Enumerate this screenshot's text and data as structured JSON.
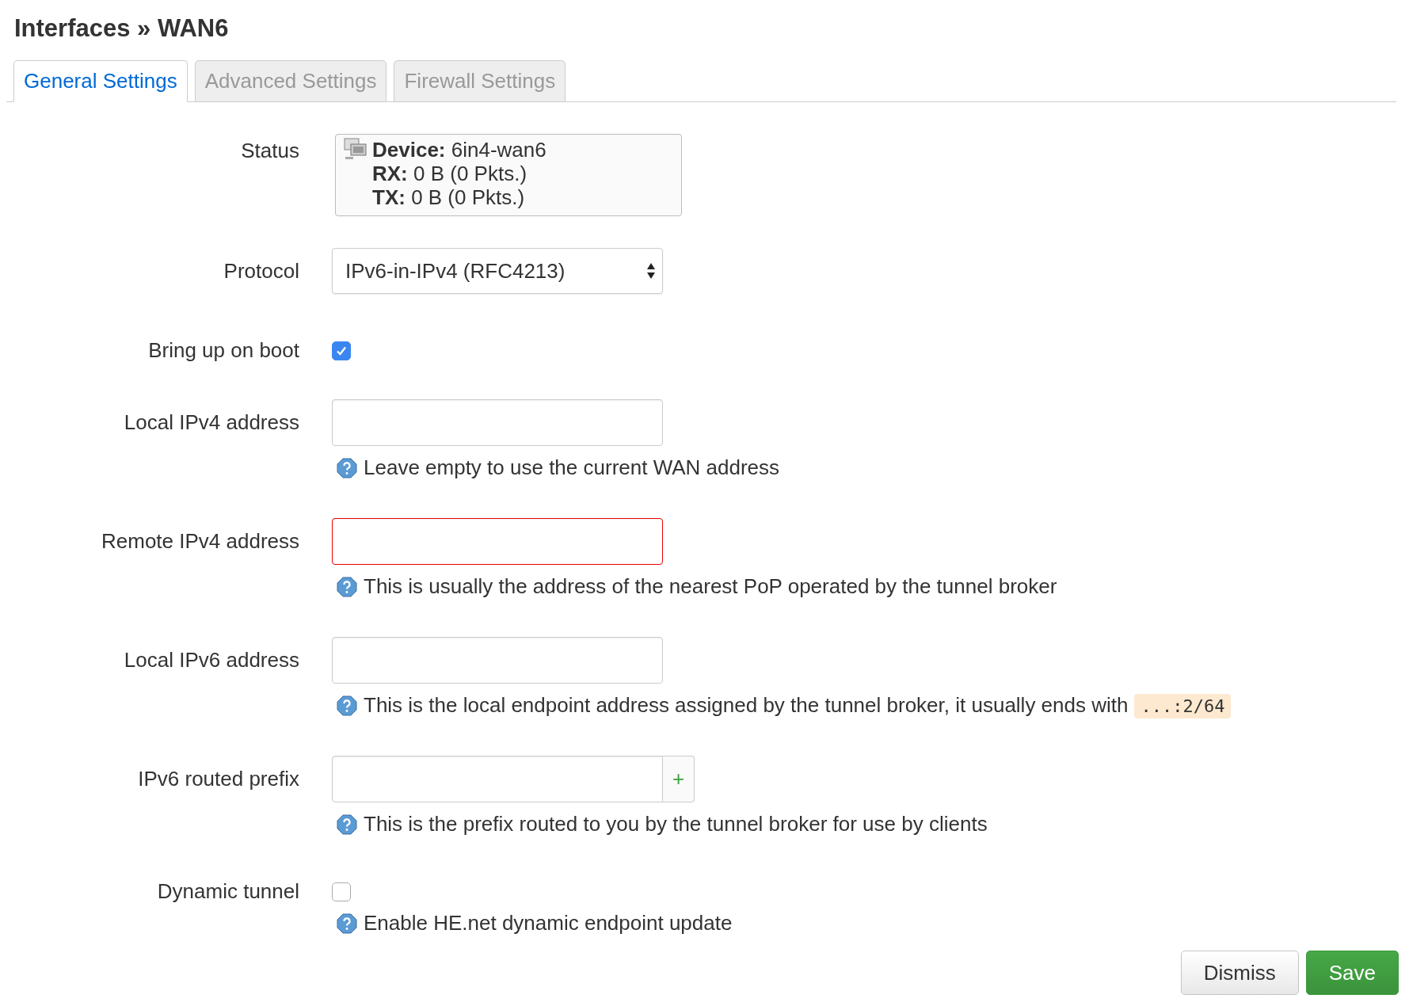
{
  "title": "Interfaces » WAN6",
  "tabs": [
    {
      "label": "General Settings",
      "selected": true
    },
    {
      "label": "Advanced Settings",
      "selected": false
    },
    {
      "label": "Firewall Settings",
      "selected": false
    }
  ],
  "fields": [
    {
      "kind": "status",
      "label": "Status",
      "lines": [
        {
          "key": "Device:",
          "value": "6in4-wan6"
        },
        {
          "key": "RX:",
          "value": "0 B (0 Pkts.)"
        },
        {
          "key": "TX:",
          "value": "0 B (0 Pkts.)"
        }
      ]
    },
    {
      "kind": "select",
      "label": "Protocol",
      "value": "IPv6-in-IPv4 (RFC4213)"
    },
    {
      "kind": "checkbox",
      "label": "Bring up on boot",
      "checked": true
    },
    {
      "kind": "text",
      "label": "Local IPv4 address",
      "invalid": false,
      "help": "Leave empty to use the current WAN address"
    },
    {
      "kind": "text",
      "label": "Remote IPv4 address",
      "invalid": true,
      "help": "This is usually the address of the nearest PoP operated by the tunnel broker"
    },
    {
      "kind": "text",
      "label": "Local IPv6 address",
      "invalid": false,
      "help": "This is the local endpoint address assigned by the tunnel broker, it usually ends with",
      "code": "...:2/64"
    },
    {
      "kind": "list",
      "label": "IPv6 routed prefix",
      "invalid": false,
      "add": "+",
      "help": "This is the prefix routed to you by the tunnel broker for use by clients"
    },
    {
      "kind": "checkbox",
      "label": "Dynamic tunnel",
      "checked": false,
      "help": "Enable HE.net dynamic endpoint update"
    }
  ],
  "buttons": [
    {
      "label": "Dismiss",
      "kind": "default"
    },
    {
      "label": "Save",
      "kind": "primary"
    }
  ]
}
